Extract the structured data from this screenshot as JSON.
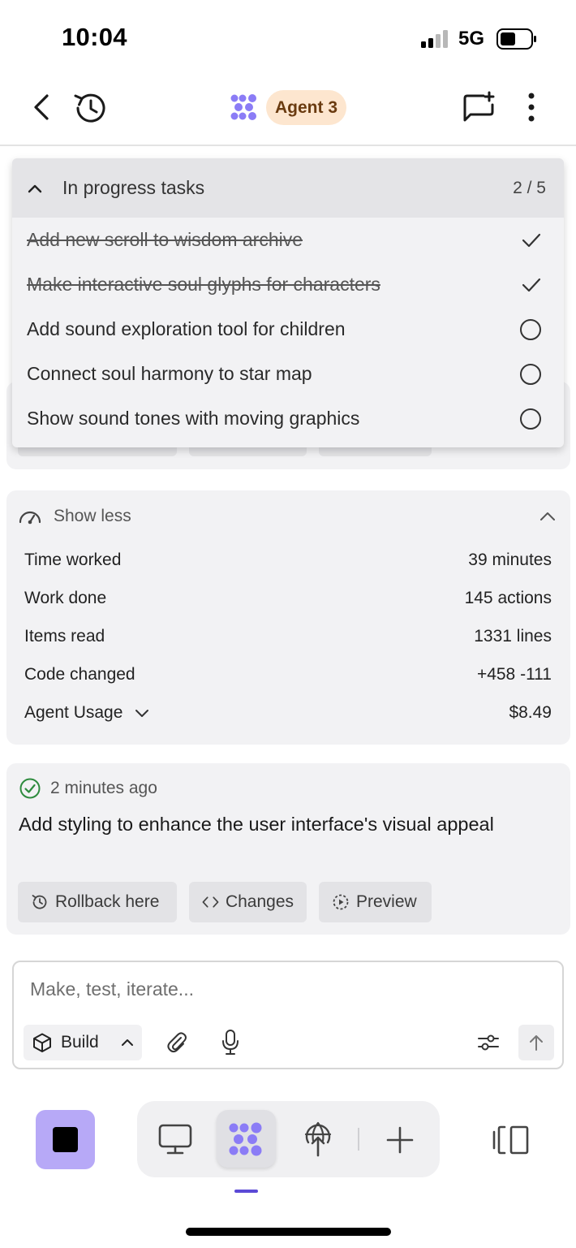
{
  "status_bar": {
    "time": "10:04",
    "network": "5G"
  },
  "header": {
    "agent_name": "Agent 3",
    "agent_badge_color": "#fde6cf",
    "icons": [
      "back-icon",
      "history-icon",
      "agent-logo-icon",
      "new-chat-icon",
      "more-vertical-icon"
    ]
  },
  "tasks": {
    "title": "In progress tasks",
    "count": "2 / 5",
    "items": [
      {
        "label": "Add new scroll to wisdom archive",
        "done": true
      },
      {
        "label": "Make interactive soul glyphs for characters",
        "done": true
      },
      {
        "label": "Add sound exploration tool for children",
        "done": false
      },
      {
        "label": "Connect soul harmony to star map",
        "done": false
      },
      {
        "label": "Show sound tones with moving graphics",
        "done": false
      }
    ]
  },
  "stats": {
    "toggle_label": "Show less",
    "rows": [
      {
        "label": "Time worked",
        "value": "39 minutes"
      },
      {
        "label": "Work done",
        "value": "145 actions"
      },
      {
        "label": "Items read",
        "value": "1331 lines"
      },
      {
        "label": "Code changed",
        "value": "+458 -111"
      },
      {
        "label": "Agent Usage",
        "value": "$8.49"
      }
    ]
  },
  "checkpoint": {
    "time_ago": "2 minutes ago",
    "message": "Add styling to enhance the user interface's visual appeal",
    "actions": {
      "rollback": "Rollback here",
      "changes": "Changes",
      "preview": "Preview"
    }
  },
  "composer": {
    "placeholder": "Make, test, iterate...",
    "mode": "Build"
  },
  "colors": {
    "accent": "#8b7cf6",
    "stop_button": "#b7a9f7",
    "success": "#2e8b3e"
  }
}
